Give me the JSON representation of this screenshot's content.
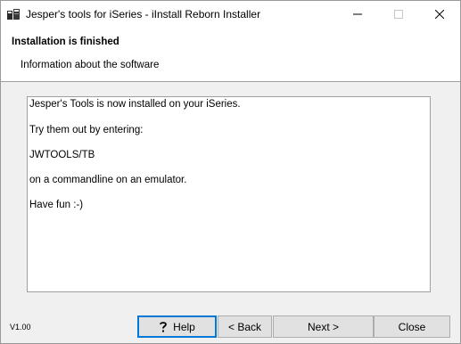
{
  "window": {
    "title": "Jesper's tools for iSeries - iInstall Reborn Installer",
    "controls": {
      "minimize": "minimize-icon",
      "maximize": "maximize-icon",
      "close": "close-icon"
    }
  },
  "header": {
    "title": "Installation is finished",
    "subtitle": "Information about the software"
  },
  "content": {
    "lines": [
      "Jesper's Tools is now installed on your iSeries.",
      "Try them out by entering:",
      "JWTOOLS/TB",
      "on a commandline on an emulator.",
      "Have fun :-)"
    ]
  },
  "footer": {
    "version": "V1.00",
    "buttons": {
      "help": "Help",
      "back": "< Back",
      "next": "Next >",
      "close": "Close"
    }
  },
  "colors": {
    "focus_border": "#0078d7",
    "button_face": "#e1e1e1",
    "panel": "#f0f0f0"
  }
}
